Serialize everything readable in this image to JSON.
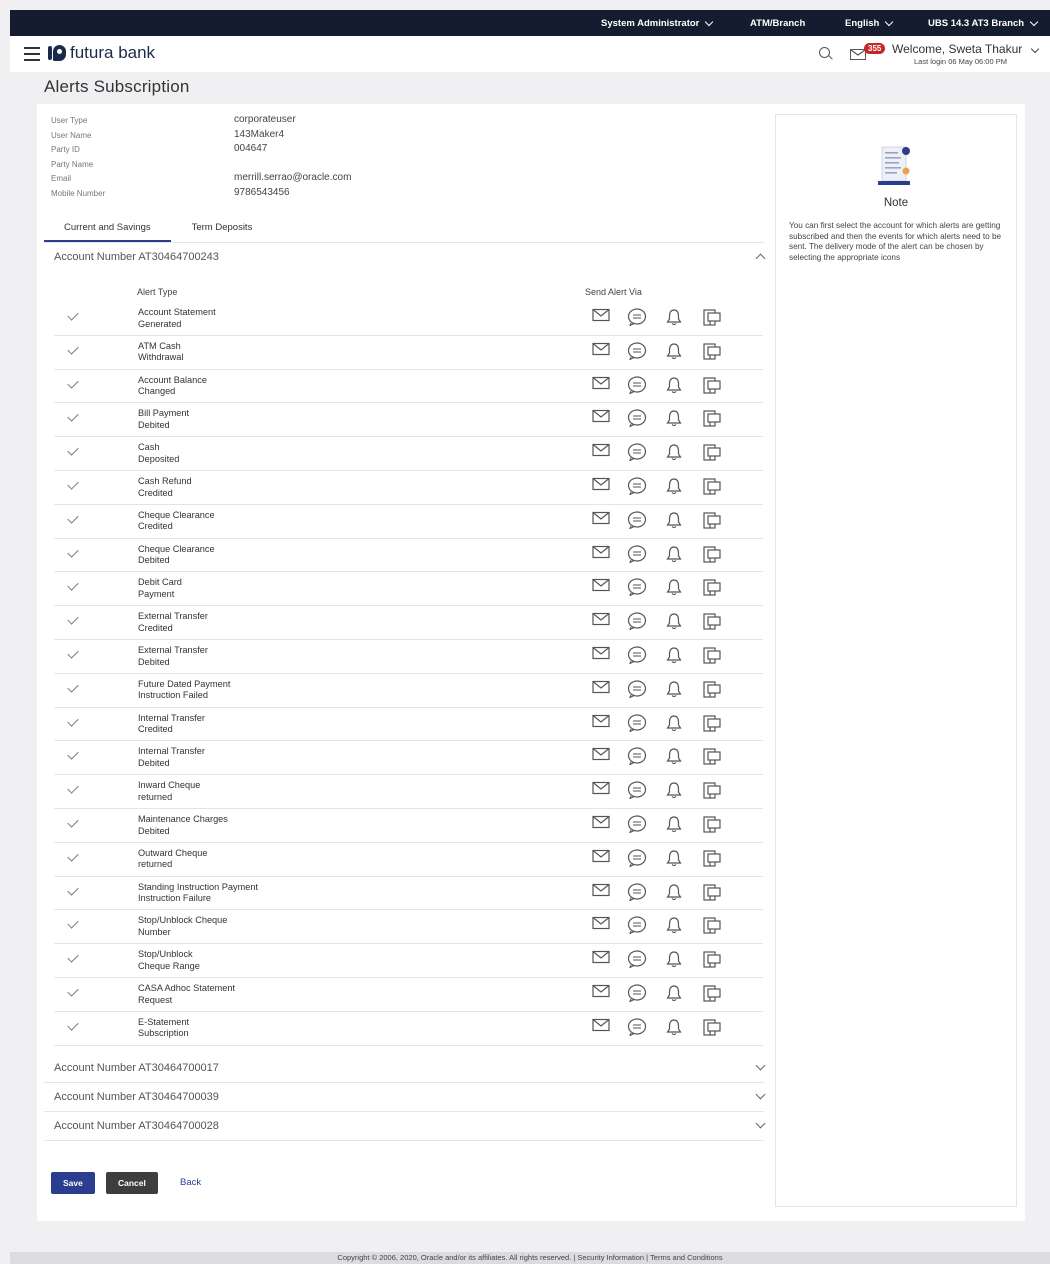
{
  "topbar": {
    "role": "System Administrator",
    "branch_type": "ATM/Branch",
    "language": "English",
    "branch": "UBS 14.3 AT3 Branch"
  },
  "header": {
    "brand": "futura bank",
    "notification_count": "355",
    "welcome": "Welcome, Sweta Thakur",
    "last_login": "Last login 06 May 06:00 PM"
  },
  "page": {
    "title": "Alerts Subscription"
  },
  "user_info": [
    {
      "label": "User Type",
      "value": "corporateuser"
    },
    {
      "label": "User Name",
      "value": "143Maker4"
    },
    {
      "label": "Party ID",
      "value": "004647"
    },
    {
      "label": "Party Name",
      "value": ""
    },
    {
      "label": "Email",
      "value": "merrill.serrao@oracle.com"
    },
    {
      "label": "Mobile Number",
      "value": "9786543456"
    }
  ],
  "tabs": [
    "Current and Savings",
    "Term Deposits"
  ],
  "expanded_account": "Account Number AT30464700243",
  "columns": {
    "alert_type": "Alert Type",
    "send_via": "Send Alert Via"
  },
  "alerts": [
    {
      "line1": "Account Statement",
      "line2": "Generated"
    },
    {
      "line1": "ATM Cash",
      "line2": "Withdrawal"
    },
    {
      "line1": "Account Balance",
      "line2": "Changed"
    },
    {
      "line1": "Bill Payment",
      "line2": "Debited"
    },
    {
      "line1": "Cash",
      "line2": "Deposited"
    },
    {
      "line1": "Cash Refund",
      "line2": "Credited"
    },
    {
      "line1": "Cheque Clearance",
      "line2": "Credited"
    },
    {
      "line1": "Cheque Clearance",
      "line2": "Debited"
    },
    {
      "line1": "Debit Card",
      "line2": "Payment"
    },
    {
      "line1": "External Transfer",
      "line2": "Credited"
    },
    {
      "line1": "External Transfer",
      "line2": "Debited"
    },
    {
      "line1": "Future Dated Payment",
      "line2": "Instruction Failed"
    },
    {
      "line1": "Internal Transfer",
      "line2": "Credited"
    },
    {
      "line1": "Internal Transfer",
      "line2": "Debited"
    },
    {
      "line1": "Inward Cheque",
      "line2": "returned"
    },
    {
      "line1": "Maintenance Charges",
      "line2": "Debited"
    },
    {
      "line1": "Outward Cheque",
      "line2": "returned"
    },
    {
      "line1": "Standing Instruction Payment",
      "line2": "Instruction Failure"
    },
    {
      "line1": "Stop/Unblock Cheque",
      "line2": "Number"
    },
    {
      "line1": "Stop/Unblock",
      "line2": "Cheque Range"
    },
    {
      "line1": "CASA Adhoc Statement",
      "line2": "Request"
    },
    {
      "line1": "E-Statement",
      "line2": "Subscription"
    }
  ],
  "collapsed_accounts": [
    "Account Number AT30464700017",
    "Account Number AT30464700039",
    "Account Number AT30464700028"
  ],
  "note": {
    "title": "Note",
    "text": "You can first select the account for which alerts are getting subscribed and then the events for which alerts need to be sent. The delivery mode of the alert can be chosen by selecting the appropriate icons"
  },
  "buttons": {
    "save": "Save",
    "cancel": "Cancel",
    "back": "Back"
  },
  "footer": "Copyright © 2006, 2020, Oracle and/or its affiliates. All rights reserved. | Security Information | Terms and Conditions",
  "colors": {
    "topbar": "#141d2f",
    "primary": "#2a3d8f",
    "badge": "#c62828"
  }
}
